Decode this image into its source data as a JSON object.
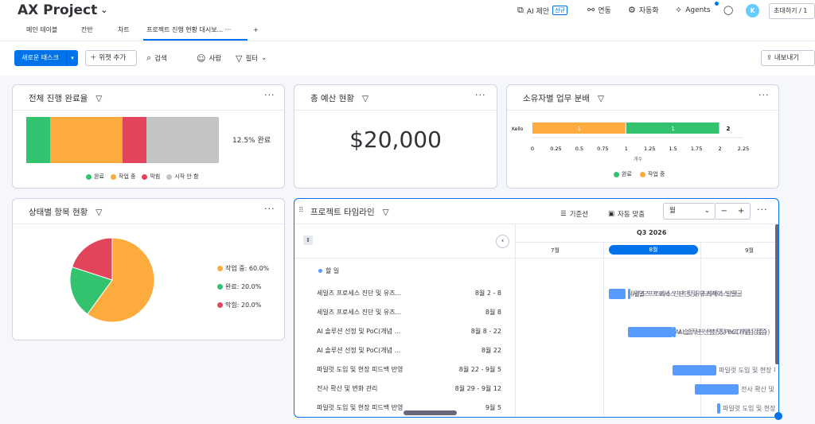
{
  "project": {
    "title": "AX Project"
  },
  "header": {
    "ai_suggest": "AI 제안",
    "new_badge": "신규",
    "integrate": "연동",
    "automate": "자동화",
    "agents": "Agents",
    "avatar": "K",
    "invite": "초대하기 / 1"
  },
  "tabs": [
    {
      "label": "메인 테이블"
    },
    {
      "label": "칸반"
    },
    {
      "label": "차트"
    },
    {
      "label": "프로젝트 진행 현황 대시보..."
    },
    {
      "label": "···"
    },
    {
      "label": "+"
    }
  ],
  "toolbar": {
    "new_task": "새로운 태스크",
    "add_widget": "위젯 추가",
    "search": "검색",
    "person": "사람",
    "filter": "필터",
    "export": "내보내기"
  },
  "colors": {
    "done": "#33c36e",
    "working": "#fdab3d",
    "stuck": "#e2445c",
    "not_started": "#c4c4c4",
    "blue": "#579bfc"
  },
  "progress": {
    "title": "전체 진행 완료율",
    "pct_label": "12.5% 완료",
    "legend": [
      "완료",
      "작업 중",
      "막힘",
      "시작 안 함"
    ],
    "chart_data": {
      "type": "bar",
      "categories": [
        "완료",
        "작업 중",
        "막힘",
        "시작 안 함"
      ],
      "values": [
        12.5,
        37.5,
        12.5,
        37.5
      ]
    }
  },
  "budget": {
    "title": "총 예산 현황",
    "value": "$20,000"
  },
  "owner": {
    "title": "소유자별 업무 분배",
    "axis_label": "개수",
    "legend": [
      "완료",
      "작업 중"
    ],
    "chart_data": {
      "type": "bar",
      "categories": [
        "Kello"
      ],
      "series": [
        {
          "name": "작업 중",
          "values": [
            1
          ]
        },
        {
          "name": "완료",
          "values": [
            1
          ]
        }
      ],
      "total_label": "2",
      "xlim": [
        0,
        2.25
      ],
      "xticks": [
        "0",
        "0.25",
        "0.5",
        "0.75",
        "1",
        "1.25",
        "1.5",
        "1.75",
        "2",
        "2.25"
      ]
    }
  },
  "status": {
    "title": "상태별 항목 현황",
    "legend": [
      "작업 중: 60.0%",
      "완료: 20.0%",
      "막힘: 20.0%"
    ],
    "chart_data": {
      "type": "pie",
      "categories": [
        "작업 중",
        "완료",
        "막힘"
      ],
      "values": [
        60,
        20,
        20
      ]
    }
  },
  "timeline": {
    "title": "프로젝트 타임라인",
    "baseline": "기준선",
    "autofit": "자동 맞춤",
    "scale": "월",
    "minus": "−",
    "plus": "+",
    "quarter": "Q3 2026",
    "months": [
      "7월",
      "8월",
      "9월"
    ],
    "group": "할 일",
    "rows": [
      {
        "name": "세일즈 프로세스 진단 및 유즈...",
        "dates": "8월 2 - 8",
        "label": "세일즈 프로세스 진단 및 유즈케이스 발굴"
      },
      {
        "name": "세일즈 프로세스 진단 및 유즈...",
        "dates": "8월 8",
        "label": "세일즈 프로세스 진단 및 유즈케이스 발굴"
      },
      {
        "name": "AI 솔루션 선정 및 PoC(개념 ...",
        "dates": "8월 8 - 22",
        "label": "AI 솔루션 선정 및 PoC(개념 검증)"
      },
      {
        "name": "AI 솔루션 선정 및 PoC(개념 ...",
        "dates": "8월 22",
        "label": "AI 솔루션 선정 및 PoC(개념 검증)"
      },
      {
        "name": "파일럿 도입 및 현장 피드백 반영",
        "dates": "8월 22 - 9월 5",
        "label": "파일럿 도입 및 현장 피드백 반영"
      },
      {
        "name": "전사 확산 및 변화 관리",
        "dates": "8월 29 - 9월 12",
        "label": "전사 확산 및 변화 관리"
      },
      {
        "name": "파일럿 도입 및 현장 피드백 반영",
        "dates": "9월 5",
        "label": "파일럿 도입 및 현장 피드백 반영"
      }
    ]
  }
}
